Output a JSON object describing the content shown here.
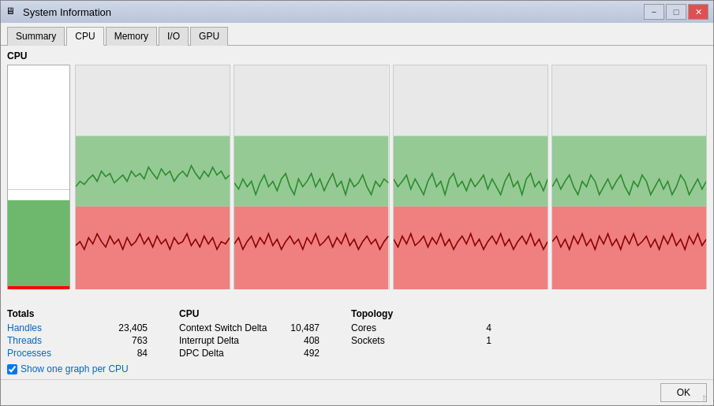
{
  "window": {
    "title": "System Information",
    "icon": "🖥"
  },
  "title_buttons": {
    "minimize": "−",
    "maximize": "□",
    "close": "✕"
  },
  "tabs": [
    {
      "id": "summary",
      "label": "Summary",
      "active": false
    },
    {
      "id": "cpu",
      "label": "CPU",
      "active": true
    },
    {
      "id": "memory",
      "label": "Memory",
      "active": false
    },
    {
      "id": "io",
      "label": "I/O",
      "active": false
    },
    {
      "id": "gpu",
      "label": "GPU",
      "active": false
    }
  ],
  "section": {
    "label": "CPU"
  },
  "cpu_percent": "48.68%",
  "totals": {
    "title": "Totals",
    "rows": [
      {
        "label": "Handles",
        "value": "23,405"
      },
      {
        "label": "Threads",
        "value": "763"
      },
      {
        "label": "Processes",
        "value": "84"
      }
    ]
  },
  "cpu_stats": {
    "title": "CPU",
    "rows": [
      {
        "label": "Context Switch Delta",
        "value": "10,487"
      },
      {
        "label": "Interrupt Delta",
        "value": "408"
      },
      {
        "label": "DPC Delta",
        "value": "492"
      }
    ]
  },
  "topology": {
    "title": "Topology",
    "rows": [
      {
        "label": "Cores",
        "value": "4"
      },
      {
        "label": "Sockets",
        "value": "1"
      }
    ]
  },
  "checkbox": {
    "label": "Show one graph per CPU",
    "checked": true
  },
  "bottom": {
    "ok_label": "OK"
  }
}
